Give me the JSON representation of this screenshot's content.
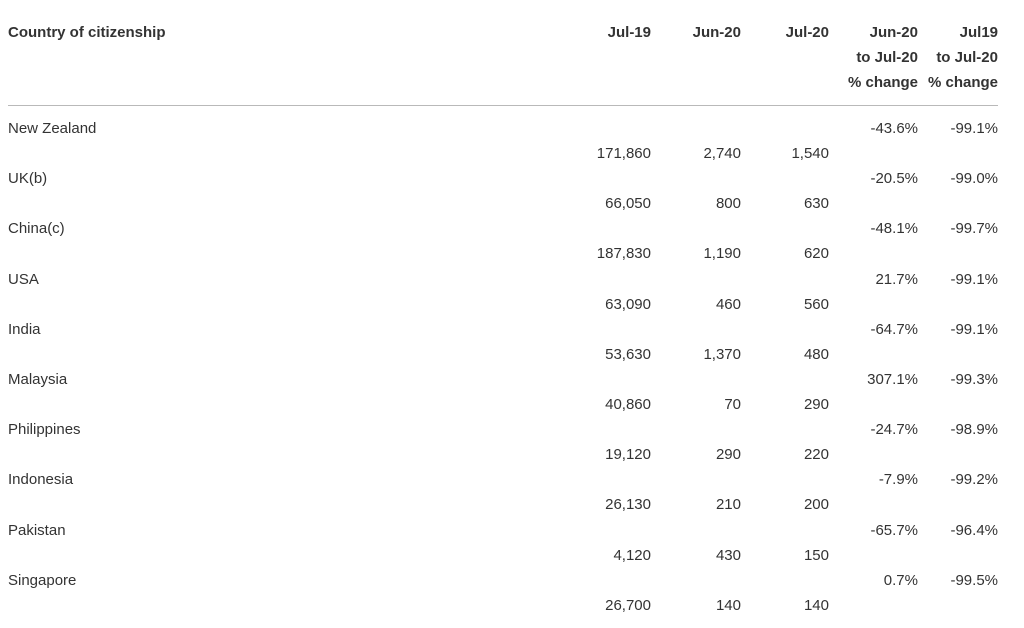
{
  "header": {
    "country": "Country of citizenship",
    "jul19": "Jul-19",
    "jun20": "Jun-20",
    "jul20": "Jul-20",
    "chg1": [
      "Jun-20",
      "to Jul-20",
      "% change"
    ],
    "chg2": [
      "Jul19",
      "to Jul-20",
      "% change"
    ]
  },
  "rows": [
    {
      "country": "New Zealand",
      "jul19": "171,860",
      "jun20": "2,740",
      "jul20": "1,540",
      "chg1": "-43.6%",
      "chg2": "-99.1%"
    },
    {
      "country": "UK(b)",
      "jul19": "66,050",
      "jun20": "800",
      "jul20": "630",
      "chg1": "-20.5%",
      "chg2": "-99.0%"
    },
    {
      "country": "China(c)",
      "jul19": "187,830",
      "jun20": "1,190",
      "jul20": "620",
      "chg1": "-48.1%",
      "chg2": "-99.7%"
    },
    {
      "country": "USA",
      "jul19": "63,090",
      "jun20": "460",
      "jul20": "560",
      "chg1": "21.7%",
      "chg2": "-99.1%"
    },
    {
      "country": "India",
      "jul19": "53,630",
      "jun20": "1,370",
      "jul20": "480",
      "chg1": "-64.7%",
      "chg2": "-99.1%"
    },
    {
      "country": "Malaysia",
      "jul19": "40,860",
      "jun20": "70",
      "jul20": "290",
      "chg1": "307.1%",
      "chg2": "-99.3%"
    },
    {
      "country": "Philippines",
      "jul19": "19,120",
      "jun20": "290",
      "jul20": "220",
      "chg1": "-24.7%",
      "chg2": "-98.9%"
    },
    {
      "country": "Indonesia",
      "jul19": "26,130",
      "jun20": "210",
      "jul20": "200",
      "chg1": "-7.9%",
      "chg2": "-99.2%"
    },
    {
      "country": "Pakistan",
      "jul19": "4,120",
      "jun20": "430",
      "jul20": "150",
      "chg1": "-65.7%",
      "chg2": "-96.4%"
    },
    {
      "country": "Singapore",
      "jul19": "26,700",
      "jun20": "140",
      "jul20": "140",
      "chg1": "0.7%",
      "chg2": "-99.5%"
    }
  ]
}
